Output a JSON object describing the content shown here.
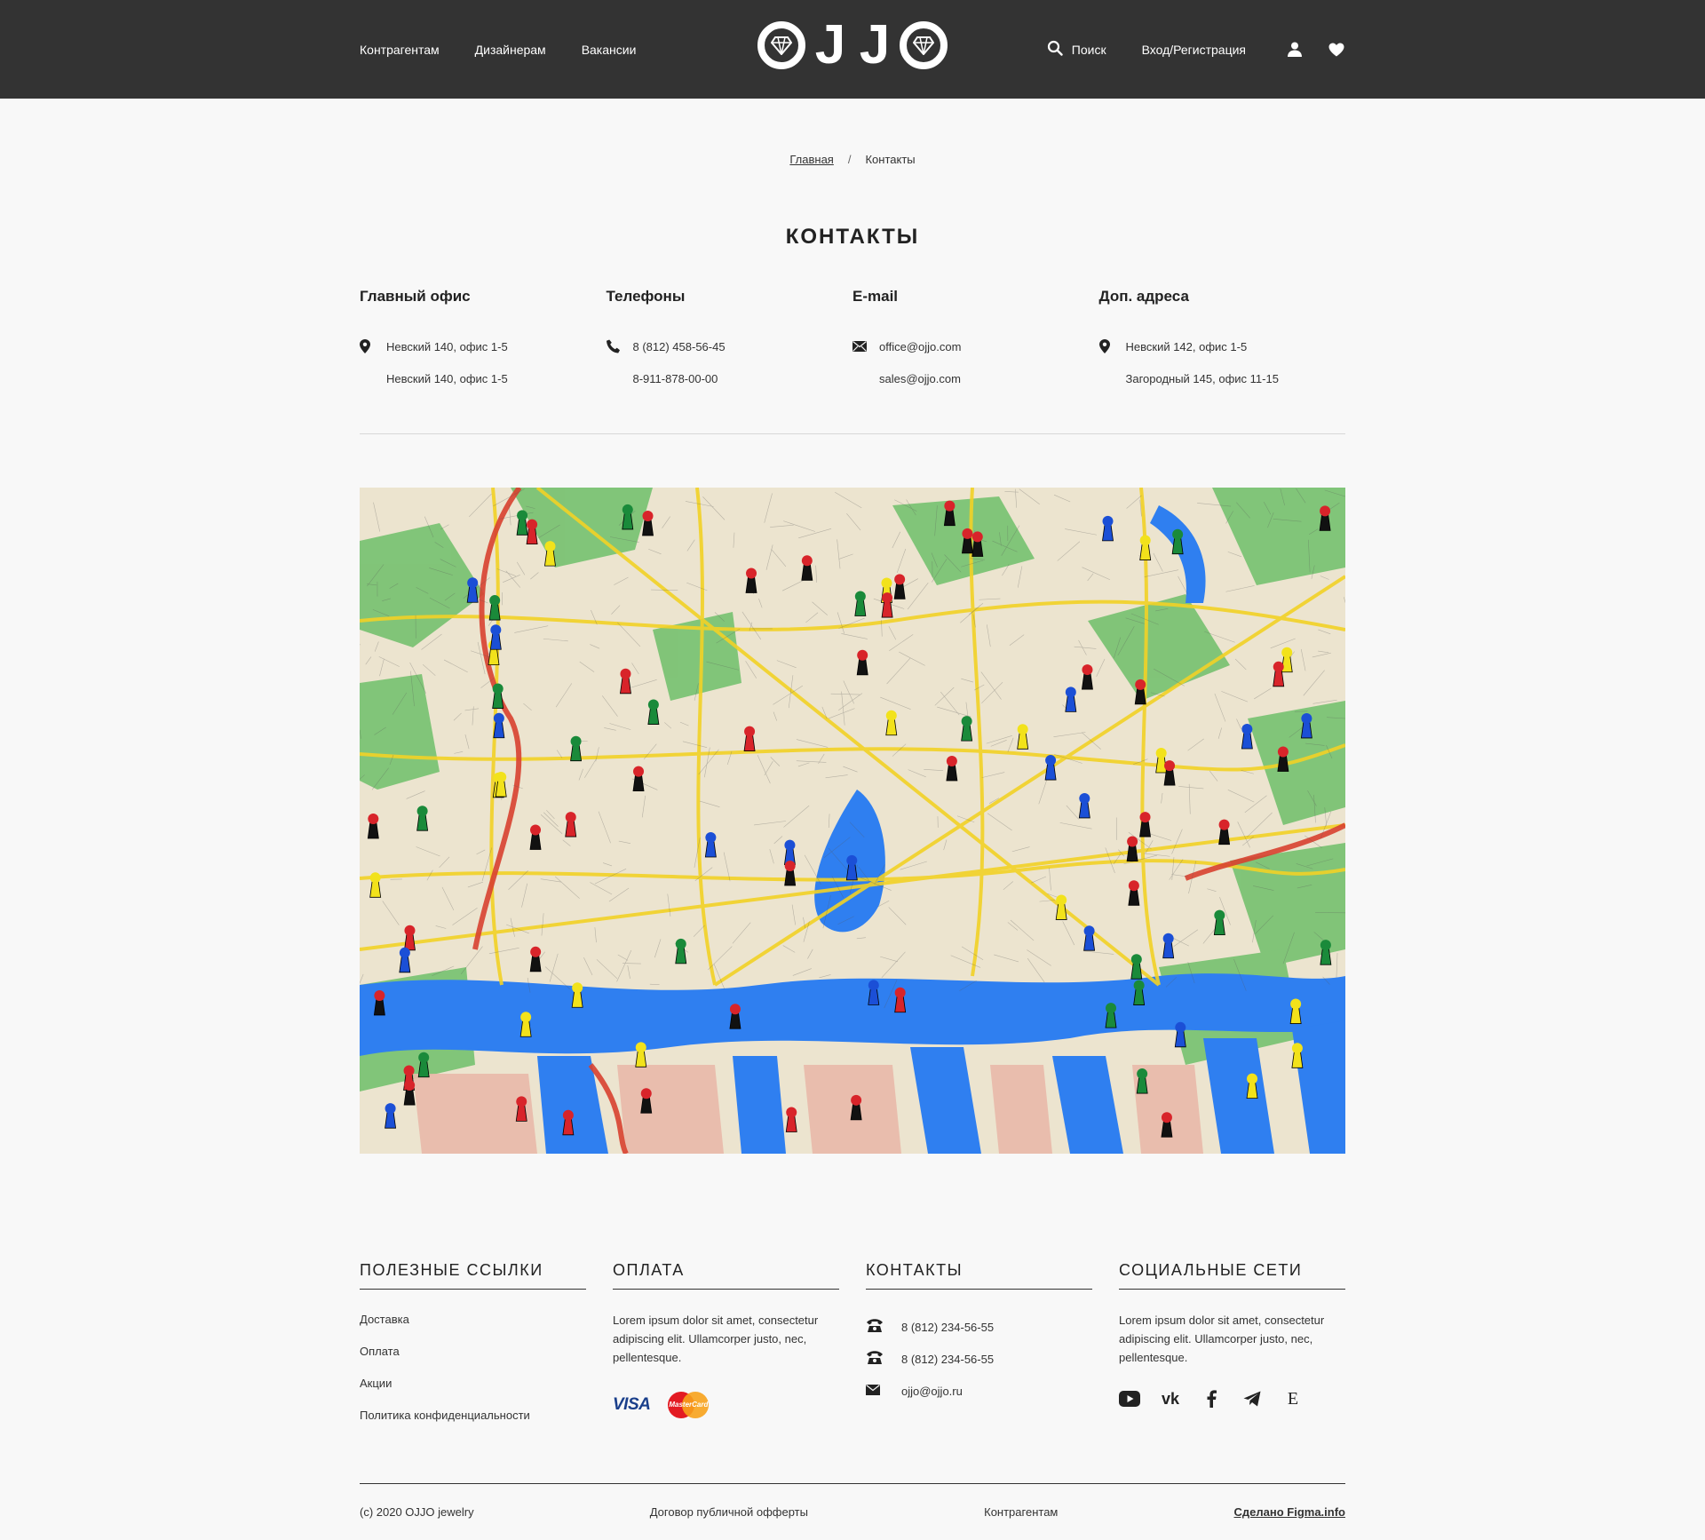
{
  "header": {
    "nav": [
      "Контрагентам",
      "Дизайнерам",
      "Вакансии"
    ],
    "logo_letters": [
      "J",
      "J"
    ],
    "search_label": "Поиск",
    "login_label": "Вход/Регистрация"
  },
  "breadcrumb": {
    "home": "Главная",
    "separator": "/",
    "current": "Контакты"
  },
  "page_title": "КОНТАКТЫ",
  "contacts": {
    "office": {
      "title": "Главный офис",
      "lines": [
        "Невский 140, офис 1-5",
        "Невский 140, офис 1-5"
      ]
    },
    "phones": {
      "title": "Телефоны",
      "lines": [
        "8 (812) 458-56-45",
        "8-911-878-00-00"
      ]
    },
    "email": {
      "title": "E-mail",
      "lines": [
        "office@ojjo.com",
        "sales@ojjo.com"
      ]
    },
    "extra": {
      "title": "Доп. адреса",
      "lines": [
        "Невский 142, офис 1-5",
        "Загородный 145, офис 11-15"
      ]
    }
  },
  "footer": {
    "links": {
      "title": "ПОЛЕЗНЫЕ ССЫЛКИ",
      "items": [
        "Доставка",
        "Оплата",
        "Акции",
        "Политика конфиденциальности"
      ]
    },
    "payment": {
      "title": "ОПЛАТА",
      "text": "Lorem ipsum dolor sit amet, consectetur adipiscing elit. Ullamcorper justo, nec, pellentesque.",
      "visa": "VISA",
      "mastercard": "MasterCard"
    },
    "contacts": {
      "title": "КОНТАКТЫ",
      "phone1": "8 (812) 234-56-55",
      "phone2": "8 (812) 234-56-55",
      "email": "ojjo@ojjo.ru"
    },
    "social": {
      "title": "СОЦИАЛЬНЫЕ СЕТИ",
      "text": "Lorem ipsum dolor sit amet, consectetur adipiscing elit. Ullamcorper justo, nec, pellentesque.",
      "etsy_glyph": "E",
      "vk_glyph": "vk"
    }
  },
  "bottom": {
    "copyright": "(c) 2020 OJJO jewelry",
    "offer": "Договор публичной офферты",
    "partners": "Контрагентам",
    "made": "Сделано Figma.info"
  },
  "colors": {
    "header_bg": "#333333",
    "page_bg": "#f8f8f8"
  }
}
